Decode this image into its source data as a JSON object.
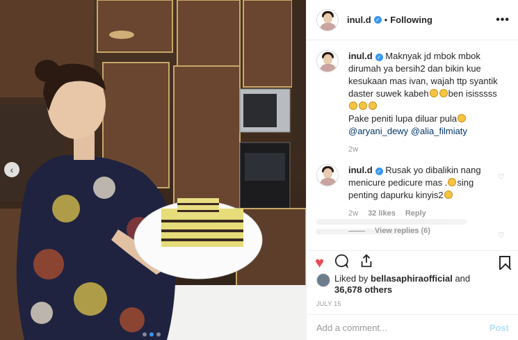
{
  "header": {
    "username": "inul.d",
    "separator": "•",
    "follow_status": "Following",
    "more_label": "•••"
  },
  "caption": {
    "username": "inul.d",
    "text_parts": [
      "Maknyak jd mbok mbok dirumah ya bersih2 dan bikin kue kesukaan mas ivan, wajah ttp syantik daster suwek kabeh",
      "ben isisssss",
      "Pake peniti lupa diluar pula"
    ],
    "mentions": [
      "@aryani_dewy",
      "@alia_filmiaty"
    ],
    "age": "2w"
  },
  "comment": {
    "username": "inul.d",
    "text_parts": [
      "Rusak yo dibalikin nang menicure pedicure mas .",
      "sing penting dapurku kinyis2"
    ],
    "age": "2w",
    "likes": "32 likes",
    "reply_label": "Reply",
    "view_replies": "View replies (6)"
  },
  "actions": {
    "like_icon": "heart-filled-icon",
    "comment_icon": "comment-icon",
    "share_icon": "share-icon",
    "save_icon": "bookmark-icon"
  },
  "likes": {
    "prefix": "Liked by",
    "user": "bellasaphiraofficial",
    "middle": "and",
    "count": "36,678 others"
  },
  "date": "JULY 15",
  "add_comment": {
    "placeholder": "Add a comment...",
    "post_label": "Post"
  },
  "colors": {
    "like_red": "#ed4956",
    "link_blue": "#003569",
    "verified_blue": "#3897f0",
    "post_disabled": "#b2dffc"
  },
  "carousel": {
    "slides": 3,
    "active_index": 1
  }
}
